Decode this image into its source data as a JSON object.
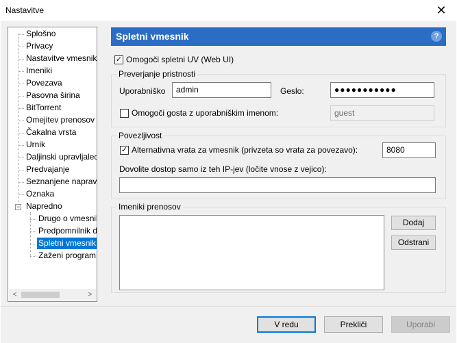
{
  "window": {
    "title": "Nastavitve",
    "close_glyph": "✕"
  },
  "tree": {
    "items": [
      "Splošno",
      "Privacy",
      "Nastavitve vmesnika",
      "Imeniki",
      "Povezava",
      "Pasovna širina",
      "BitTorrent",
      "Omejitev prenosov",
      "Čakalna vrsta",
      "Urnik",
      "Daljinski upravljalec",
      "Predvajanje",
      "Seznanjene naprave",
      "Oznaka",
      "Napredno"
    ],
    "sub_items": [
      "Drugo o vmesniku",
      "Predpomnilnik diska",
      "Spletni vmesnik",
      "Zaženi program"
    ],
    "expander_glyph": "−",
    "scroll_left": "<",
    "scroll_right": ">"
  },
  "panel": {
    "title": "Spletni vmesnik",
    "help_glyph": "?",
    "enable_webui": {
      "label": "Omogoči spletni UV (Web UI)",
      "checked": true
    },
    "auth": {
      "title": "Preverjanje pristnosti",
      "username_label": "Uporabniško",
      "username_value": "admin",
      "password_label": "Geslo:",
      "password_value": "●●●●●●●●●●●",
      "guest_label": "Omogoči gosta z uporabniškim imenom:",
      "guest_checked": false,
      "guest_value": "guest"
    },
    "connectivity": {
      "title": "Povezljivost",
      "alt_port_label": "Alternativna vrata za vmesnik (privzeta so vrata za povezavo):",
      "alt_port_checked": true,
      "alt_port_value": "8080",
      "ip_label": "Dovolite dostop samo iz teh IP-jev (ločite vnose z vejico):",
      "ip_value": ""
    },
    "download_dirs": {
      "title": "Imeniki prenosov",
      "add_label": "Dodaj",
      "remove_label": "Odstrani"
    }
  },
  "footer": {
    "ok_label": "V redu",
    "cancel_label": "Prekliči",
    "apply_label": "Uporabi"
  },
  "check_glyph": "✓"
}
